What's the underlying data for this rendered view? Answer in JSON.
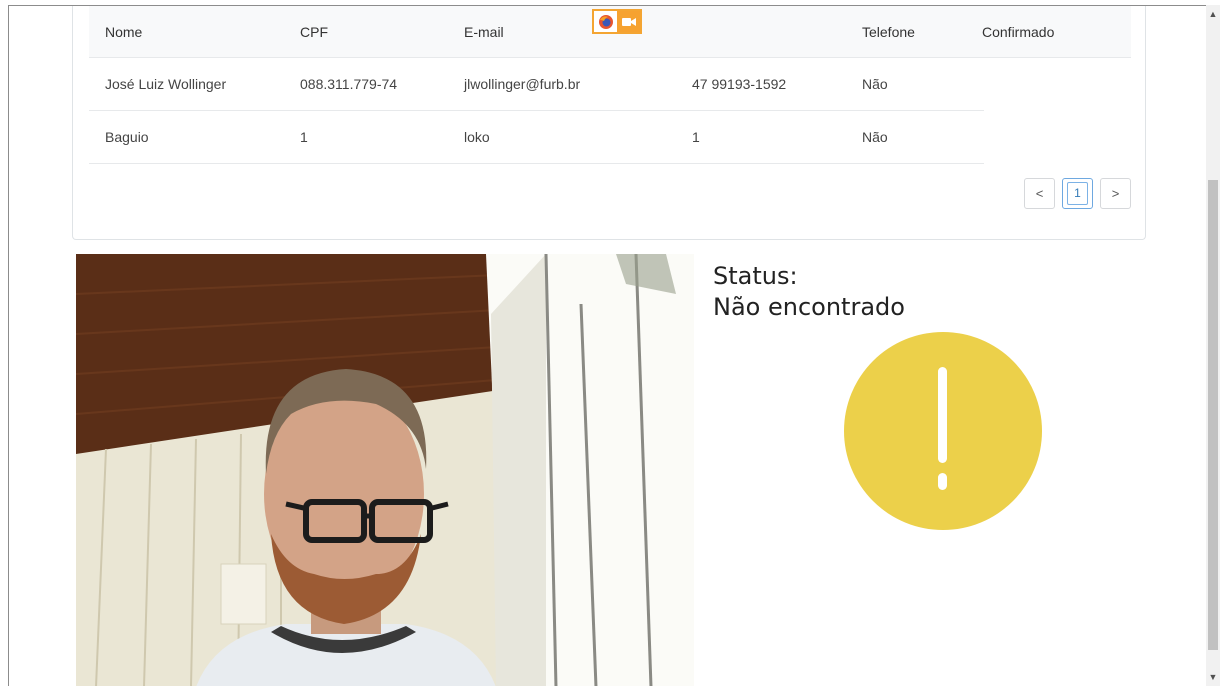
{
  "table": {
    "headers": [
      "Nome",
      "CPF",
      "E-mail",
      "",
      "Telefone",
      "Confirmado"
    ],
    "rows": [
      [
        "José Luiz Wollinger",
        "088.311.779-74",
        "jlwollinger@furb.br",
        "47 99193-1592",
        "Não"
      ],
      [
        "Baguio",
        "1",
        "loko",
        "1",
        "Não"
      ]
    ]
  },
  "pagination": {
    "prev": "<",
    "current": "1",
    "next": ">"
  },
  "status": {
    "label": "Status:",
    "value": "Não encontrado"
  },
  "icons": {
    "alert": "exclamation-icon",
    "browser": "firefox-icon",
    "camera": "camera-icon"
  },
  "colors": {
    "alert_bg": "#ecd04a",
    "share_border": "#f4a532"
  }
}
